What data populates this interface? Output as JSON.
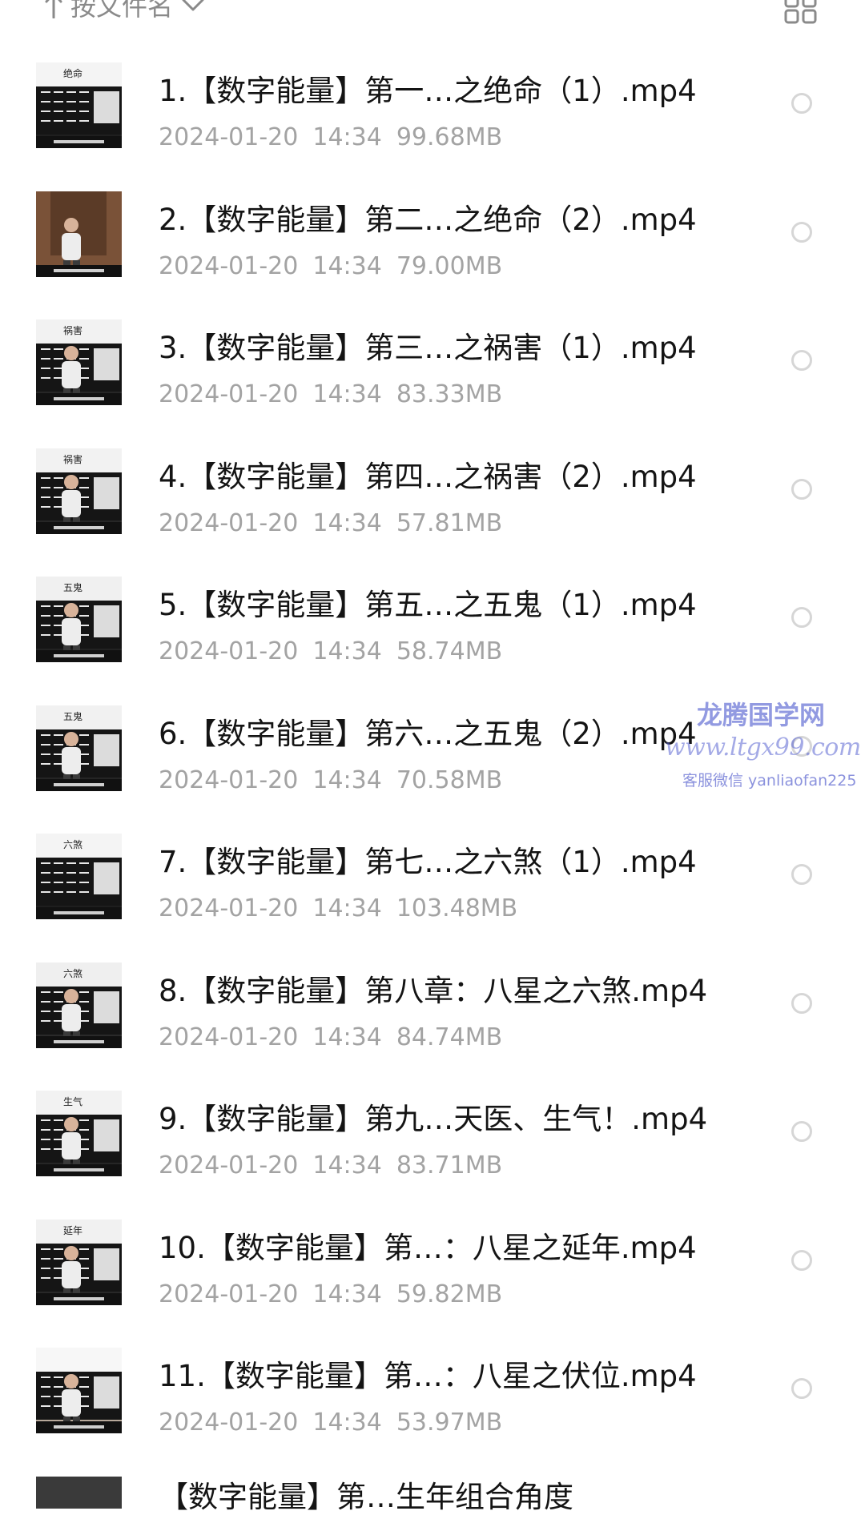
{
  "sort_bar": {
    "label": "按文件名",
    "direction_icon": "arrow-up-icon",
    "dropdown_icon": "chevron-down-icon",
    "view_toggle_icon": "grid-view-icon"
  },
  "files": [
    {
      "name": "1.【数字能量】第一…之绝命（1）.mp4",
      "date": "2024-01-20",
      "time": "14:34",
      "size": "99.68MB",
      "thumb_caption": "绝命"
    },
    {
      "name": "2.【数字能量】第二…之绝命（2）.mp4",
      "date": "2024-01-20",
      "time": "14:34",
      "size": "79.00MB",
      "thumb_caption": ""
    },
    {
      "name": "3.【数字能量】第三…之祸害（1）.mp4",
      "date": "2024-01-20",
      "time": "14:34",
      "size": "83.33MB",
      "thumb_caption": "祸害"
    },
    {
      "name": "4.【数字能量】第四…之祸害（2）.mp4",
      "date": "2024-01-20",
      "time": "14:34",
      "size": "57.81MB",
      "thumb_caption": "祸害"
    },
    {
      "name": "5.【数字能量】第五…之五鬼（1）.mp4",
      "date": "2024-01-20",
      "time": "14:34",
      "size": "58.74MB",
      "thumb_caption": "五鬼"
    },
    {
      "name": "6.【数字能量】第六…之五鬼（2）.mp4",
      "date": "2024-01-20",
      "time": "14:34",
      "size": "70.58MB",
      "thumb_caption": "五鬼"
    },
    {
      "name": "7.【数字能量】第七…之六煞（1）.mp4",
      "date": "2024-01-20",
      "time": "14:34",
      "size": "103.48MB",
      "thumb_caption": "六煞"
    },
    {
      "name": "8.【数字能量】第八章：八星之六煞.mp4",
      "date": "2024-01-20",
      "time": "14:34",
      "size": "84.74MB",
      "thumb_caption": "六煞"
    },
    {
      "name": "9.【数字能量】第九…天医、生气！.mp4",
      "date": "2024-01-20",
      "time": "14:34",
      "size": "83.71MB",
      "thumb_caption": "生气"
    },
    {
      "name": "10.【数字能量】第…：八星之延年.mp4",
      "date": "2024-01-20",
      "time": "14:34",
      "size": "59.82MB",
      "thumb_caption": "延年"
    },
    {
      "name": "11.【数字能量】第…：八星之伏位.mp4",
      "date": "2024-01-20",
      "time": "14:34",
      "size": "53.97MB",
      "thumb_caption": ""
    }
  ],
  "partial_file": {
    "name": "【数字能量】第…生年组合角度"
  },
  "watermark": {
    "title": "龙腾国学网",
    "url": "www.ltgx99.com",
    "contact": "客服微信 yanliaofan225"
  },
  "colors": {
    "title_text": "#141414",
    "meta_text": "#a3a3a3",
    "radio_border": "#d6d6d6",
    "watermark": "#6e78d7"
  }
}
